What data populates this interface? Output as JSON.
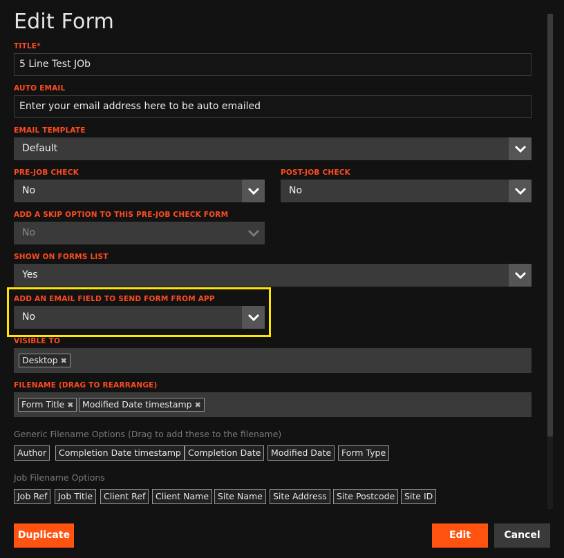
{
  "title": "Edit Form",
  "fields": {
    "title": {
      "label": "TITLE*",
      "value": "5 Line Test JOb"
    },
    "auto_email": {
      "label": "AUTO EMAIL",
      "placeholder": "Enter your email address here to be auto emailed"
    },
    "email_template": {
      "label": "EMAIL TEMPLATE",
      "value": "Default"
    },
    "pre_job_check": {
      "label": "PRE-JOB CHECK",
      "value": "No"
    },
    "post_job_check": {
      "label": "POST-JOB CHECK",
      "value": "No"
    },
    "skip_option": {
      "label": "ADD A SKIP OPTION TO THIS PRE-JOB CHECK FORM",
      "value": "No"
    },
    "show_on_forms_list": {
      "label": "SHOW ON FORMS LIST",
      "value": "Yes"
    },
    "email_field": {
      "label": "ADD AN EMAIL FIELD TO SEND FORM FROM APP",
      "value": "No"
    },
    "visible_to": {
      "label": "VISIBLE TO",
      "tags": [
        "Desktop"
      ]
    },
    "filename": {
      "label": "FILENAME (DRAG TO REARRANGE)",
      "tags": [
        "Form Title",
        "Modified Date timestamp"
      ]
    }
  },
  "generic_options": {
    "label": "Generic Filename Options (Drag to add these to the filename)",
    "items": [
      "Author",
      "Completion Date timestamp",
      "Completion Date",
      "Modified Date",
      "Form Type"
    ]
  },
  "job_options": {
    "label": "Job Filename Options",
    "items": [
      "Job Ref",
      "Job Title",
      "Client Ref",
      "Client Name",
      "Site Name",
      "Site Address",
      "Site Postcode",
      "Site ID"
    ]
  },
  "tag_remove_symbol": "✖",
  "buttons": {
    "duplicate": "Duplicate",
    "edit": "Edit",
    "cancel": "Cancel"
  },
  "colors": {
    "accent": "#ff5312",
    "label": "#ff4b1f",
    "highlight": "#ffe600"
  }
}
